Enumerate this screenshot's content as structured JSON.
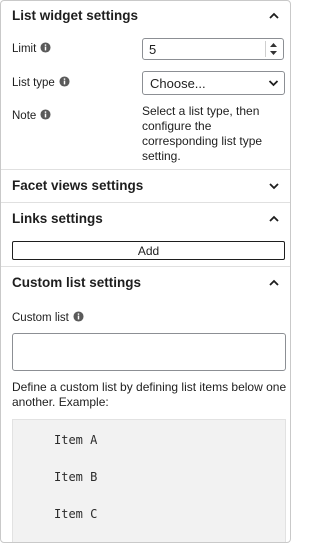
{
  "list_widget": {
    "title": "List widget settings",
    "expanded": true,
    "limit_label": "Limit",
    "limit_value": "5",
    "list_type_label": "List type",
    "list_type_selected": "Choose...",
    "note_label": "Note",
    "note_text": "Select a list type, then configure the corresponding list type setting."
  },
  "facet_views": {
    "title": "Facet views settings",
    "expanded": false
  },
  "links": {
    "title": "Links settings",
    "expanded": true,
    "add_label": "Add"
  },
  "custom_list": {
    "title": "Custom list settings",
    "expanded": true,
    "field_label": "Custom list",
    "field_value": "",
    "help_text": "Define a custom list by defining list items below one another. Example:",
    "example_items": [
      "Item A",
      "Item B",
      "Item C"
    ]
  },
  "colors": {
    "text": "#1e1e1e",
    "border": "#8c8f94",
    "divider": "#e0e0e0",
    "example_bg": "#f2f2f2"
  },
  "icons": {
    "info": "info-icon",
    "collapse": "chevron-up-icon",
    "expand": "chevron-down-icon",
    "select": "select-arrow-icon"
  }
}
